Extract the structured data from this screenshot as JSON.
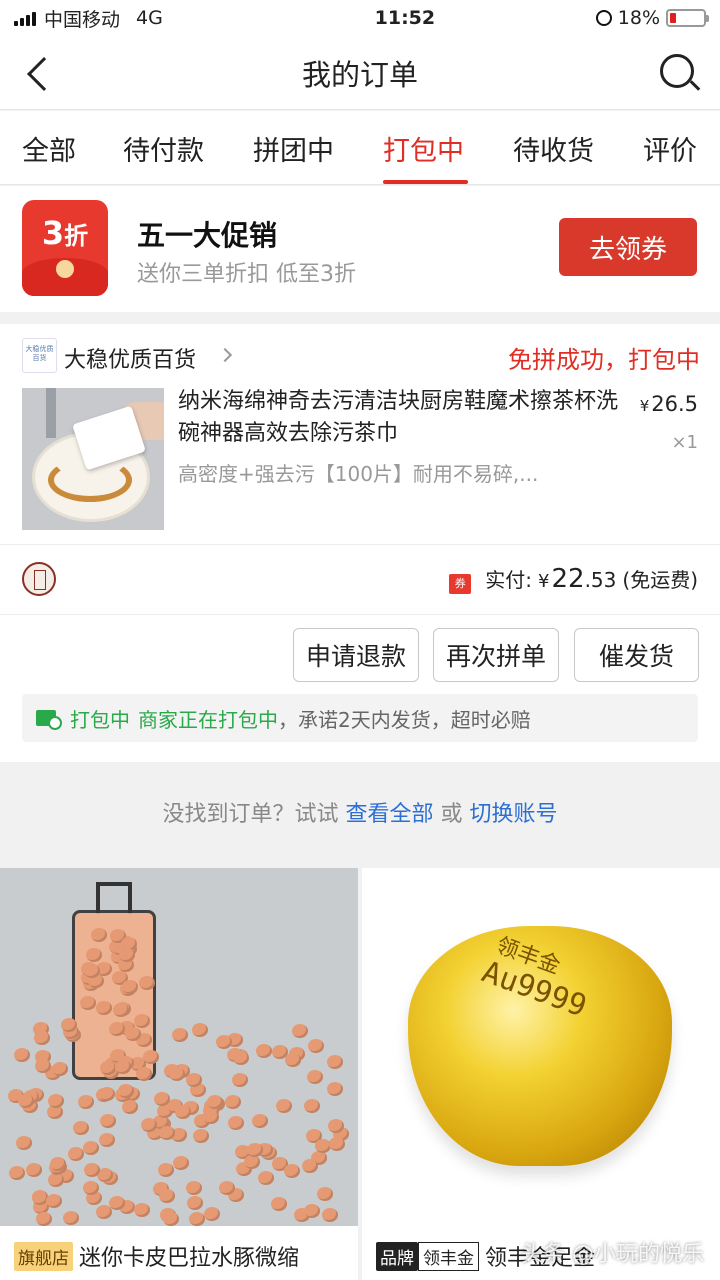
{
  "status_bar": {
    "carrier": "中国移动",
    "network": "4G",
    "time": "11:52",
    "battery": "18%",
    "battery_level": 0.18
  },
  "header": {
    "title": "我的订单"
  },
  "tabs": [
    {
      "label": "全部",
      "active": false
    },
    {
      "label": "待付款",
      "active": false
    },
    {
      "label": "拼团中",
      "active": false
    },
    {
      "label": "打包中",
      "active": true
    },
    {
      "label": "待收货",
      "active": false
    },
    {
      "label": "评价",
      "active": false
    }
  ],
  "promo": {
    "badge_main": "3",
    "badge_unit": "折",
    "title": "五一大促销",
    "subtitle": "送你三单折扣 低至3折",
    "button": "去领券"
  },
  "order": {
    "store_logo_text": "大稳优质百货",
    "store_name": "大稳优质百货",
    "status": "免拼成功，打包中",
    "product_title": "纳米海绵神奇去污清洁块厨房鞋魔术擦茶杯洗碗神器高效去除污茶巾",
    "product_spec": "高密度+强去污【100片】耐用不易碎,...",
    "price_currency": "¥",
    "price_value": "26.5",
    "quantity": "×1",
    "coupon_icon": "券",
    "total_label": "实付:",
    "total_currency": "¥",
    "total_int": "22",
    "total_dec": ".53",
    "shipping": "(免运费)",
    "buttons": {
      "refund": "申请退款",
      "regroup": "再次拼单",
      "urge": "催发货"
    },
    "note_status": "打包中",
    "note_merchant": "商家正在打包中",
    "note_promise": "，承诺2天内发货，超时必赔"
  },
  "hint": {
    "prefix": "没找到订单？试试",
    "link_all": "查看全部",
    "or": "或",
    "link_switch": "切换账号"
  },
  "recommendations": [
    {
      "tag": "旗舰店",
      "title": "迷你卡皮巴拉水豚微缩"
    },
    {
      "tag": "品牌",
      "brand": "领丰金",
      "title": "领丰金足金"
    },
    {
      "gold_text_1": "领丰金",
      "gold_text_2": "Au9999"
    }
  ],
  "watermark": "头条 @小玩的悦乐"
}
